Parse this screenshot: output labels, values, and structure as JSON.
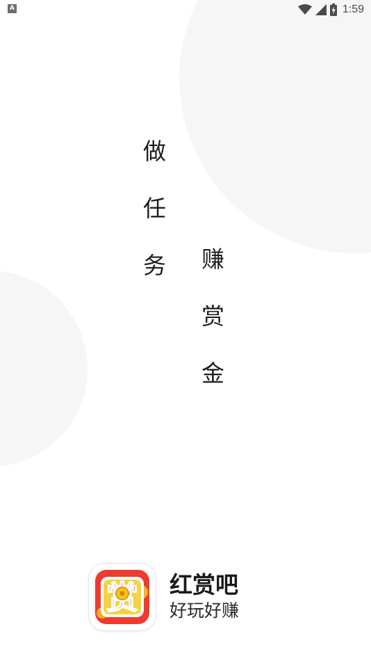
{
  "status_bar": {
    "notification_icon": "a-letter-icon",
    "notification_glyph": "A",
    "icons": [
      "wifi-icon",
      "cell-signal-icon",
      "battery-charging-icon"
    ],
    "time": "1:59"
  },
  "slogan": {
    "column_1": [
      "做",
      "任",
      "务"
    ],
    "column_2": [
      "赚",
      "赏",
      "金"
    ]
  },
  "brand": {
    "app_icon": "reward-app-icon",
    "icon_glyph": "赏",
    "name": "红赏吧",
    "tagline": "好玩好赚"
  },
  "colors": {
    "background": "#ffffff",
    "circle": "#f6f6f6",
    "icon_red": "#ee3b2e",
    "icon_gold": "#f7c21e"
  }
}
